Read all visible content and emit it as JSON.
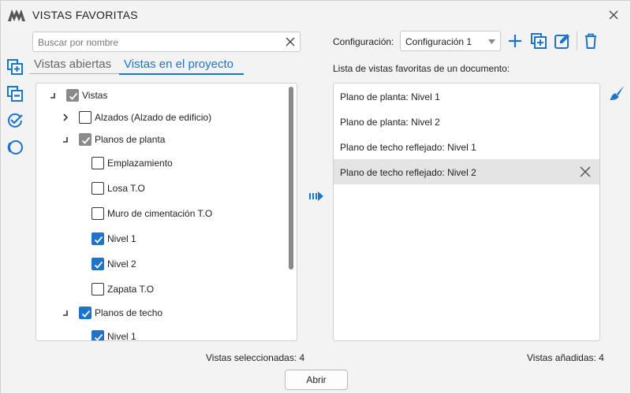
{
  "window": {
    "title": "VISTAS FAVORITAS"
  },
  "colors": {
    "accent": "#1e74c9",
    "selected_row": "#e4e4e4"
  },
  "search": {
    "placeholder": "Buscar por nombre",
    "value": ""
  },
  "tabs": [
    {
      "label": "Vistas abiertas",
      "active": false
    },
    {
      "label": "Vistas en el proyecto",
      "active": true
    }
  ],
  "tree": [
    {
      "label": "Vistas",
      "expander": "collapse-corner",
      "state": "indeterminate"
    },
    {
      "label": "Alzados (Alzado de edificio)",
      "expander": "chevron-right",
      "state": "unchecked"
    },
    {
      "label": "Planos de planta",
      "expander": "collapse-corner",
      "state": "indeterminate"
    },
    {
      "label": "Emplazamiento",
      "expander": "",
      "state": "unchecked"
    },
    {
      "label": "Losa T.O",
      "expander": "",
      "state": "unchecked"
    },
    {
      "label": "Muro de cimentación T.O",
      "expander": "",
      "state": "unchecked"
    },
    {
      "label": "Nivel 1",
      "expander": "",
      "state": "checked"
    },
    {
      "label": "Nivel 2",
      "expander": "",
      "state": "checked"
    },
    {
      "label": "Zapata T.O",
      "expander": "",
      "state": "unchecked"
    },
    {
      "label": "Planos de techo",
      "expander": "collapse-corner",
      "state": "checked"
    },
    {
      "label": "Nivel 1",
      "expander": "",
      "state": "checked"
    }
  ],
  "config": {
    "label": "Configuración:",
    "selected": "Configuración 1"
  },
  "favorites": {
    "title": "Lista de vistas favoritas de un documento:",
    "items": [
      {
        "label": "Plano de planta: Nivel 1",
        "selected": false
      },
      {
        "label": "Plano de planta: Nivel 2",
        "selected": false
      },
      {
        "label": "Plano de techo reflejado: Nivel 1",
        "selected": false
      },
      {
        "label": "Plano de techo reflejado: Nivel 2",
        "selected": true
      }
    ]
  },
  "status": {
    "selected": "Vistas seleccionadas: 4",
    "added": "Vistas añadidas: 4"
  },
  "open_button": {
    "label": "Abrir"
  },
  "icons": {
    "logo": "app-logo",
    "close": "close-icon",
    "tools": [
      "add-views-icon",
      "remove-views-icon",
      "check-all-icon",
      "circle-icon"
    ],
    "config_actions": [
      "plus-icon",
      "duplicate-icon",
      "edit-icon",
      "trash-icon"
    ],
    "brush": "brush-icon",
    "add_arrow": "add-arrow-icon"
  }
}
